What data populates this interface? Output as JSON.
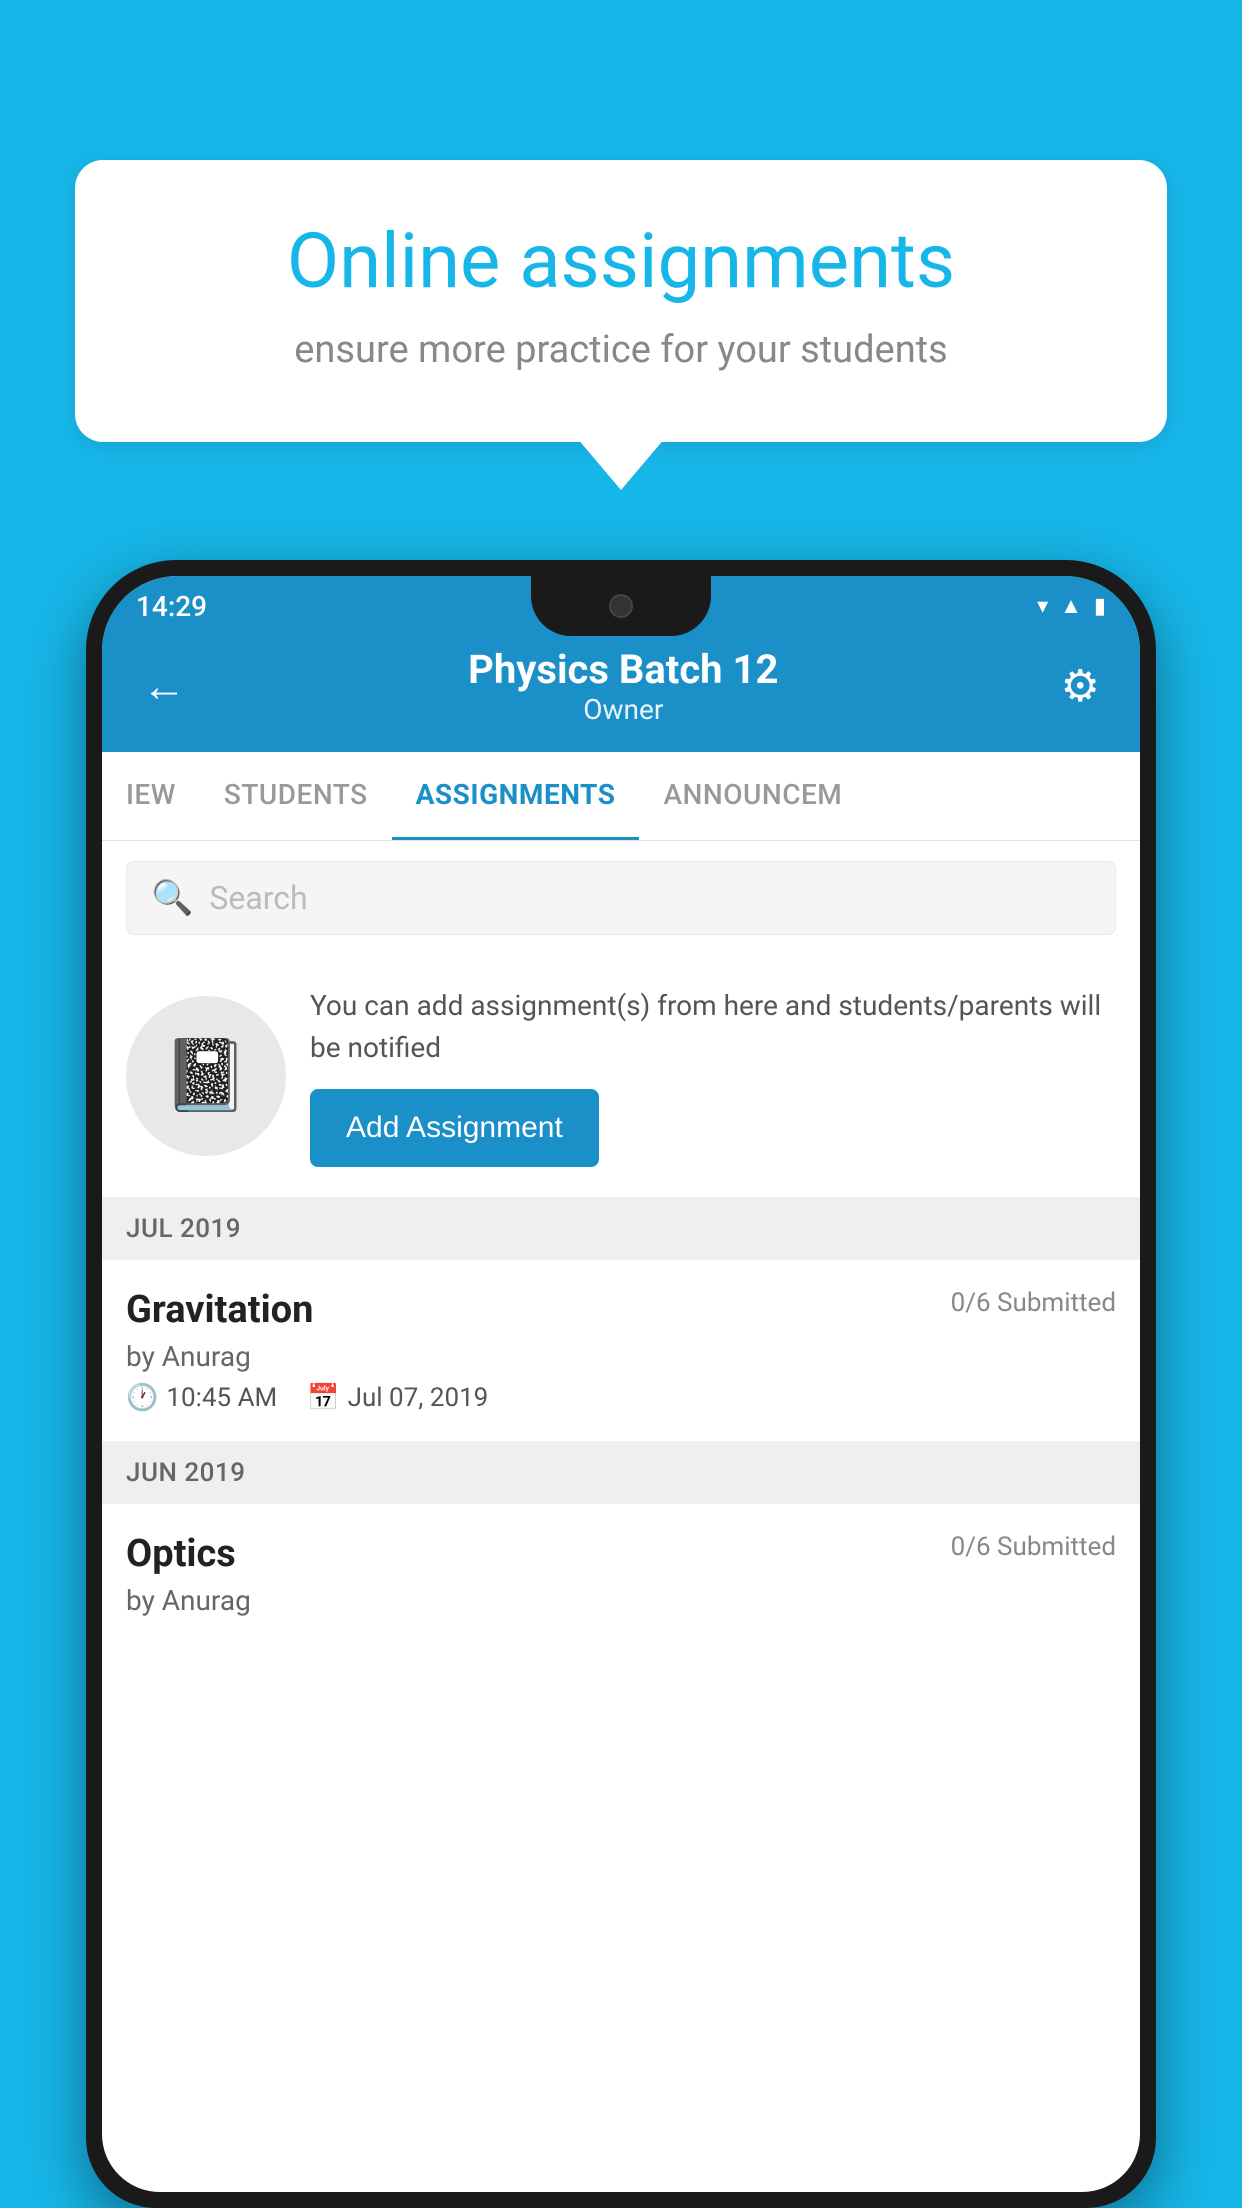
{
  "background": {
    "color": "#17b6e8"
  },
  "speech_bubble": {
    "title": "Online assignments",
    "subtitle": "ensure more practice for your students"
  },
  "phone": {
    "time": "14:29",
    "header": {
      "title": "Physics Batch 12",
      "subtitle": "Owner"
    },
    "tabs": [
      {
        "label": "IEW",
        "active": false
      },
      {
        "label": "STUDENTS",
        "active": false
      },
      {
        "label": "ASSIGNMENTS",
        "active": true
      },
      {
        "label": "ANNOUNCEM",
        "active": false
      }
    ],
    "search": {
      "placeholder": "Search"
    },
    "promo": {
      "text": "You can add assignment(s) from here and students/parents will be notified",
      "button_label": "Add Assignment"
    },
    "sections": [
      {
        "month_label": "JUL 2019",
        "assignments": [
          {
            "name": "Gravitation",
            "submitted": "0/6 Submitted",
            "by": "by Anurag",
            "time": "10:45 AM",
            "date": "Jul 07, 2019"
          }
        ]
      },
      {
        "month_label": "JUN 2019",
        "assignments": [
          {
            "name": "Optics",
            "submitted": "0/6 Submitted",
            "by": "by Anurag",
            "time": "",
            "date": ""
          }
        ]
      }
    ]
  }
}
